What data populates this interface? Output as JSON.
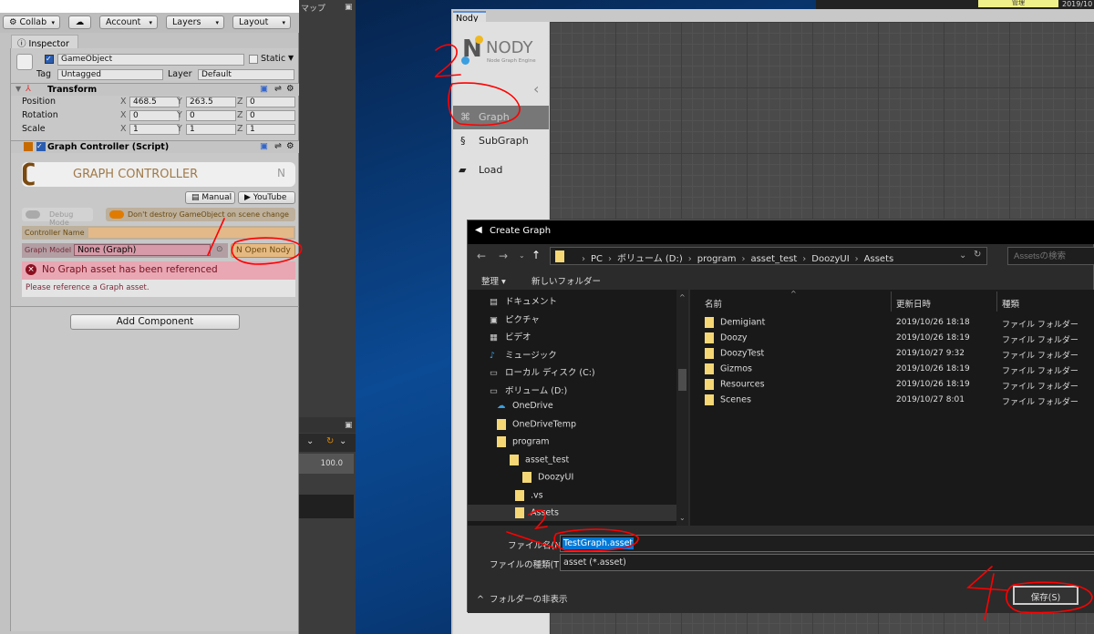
{
  "unity": {
    "toolbar": {
      "collab": "Collab",
      "account": "Account",
      "layers": "Layers",
      "layout": "Layout"
    },
    "inspector_tab": "Inspector",
    "map_tab": "マップ",
    "gameobject": {
      "name": "GameObject",
      "static_label": "Static",
      "tag_label": "Tag",
      "tag": "Untagged",
      "layer_label": "Layer",
      "layer": "Default"
    },
    "transform": {
      "title": "Transform",
      "rows": [
        {
          "label": "Position",
          "x": "468.5",
          "y": "263.5",
          "z": "0"
        },
        {
          "label": "Rotation",
          "x": "0",
          "y": "0",
          "z": "0"
        },
        {
          "label": "Scale",
          "x": "1",
          "y": "1",
          "z": "1"
        }
      ]
    },
    "axes": [
      "X",
      "Y",
      "Z"
    ],
    "graph_controller": {
      "title": "Graph Controller (Script)",
      "banner": "GRAPH CONTROLLER",
      "manual": "Manual",
      "youtube": "YouTube",
      "debug_mode": "Debug Mode",
      "dont_destroy": "Don't destroy GameObject on scene change",
      "controller_name_label": "Controller Name",
      "controller_name": "",
      "graph_model_label": "Graph Model",
      "graph_model": "None (Graph)",
      "open_nody": "Open Nody",
      "error_title": "No Graph asset has been referenced",
      "error_body": "Please reference a Graph asset."
    },
    "add_component": "Add Component",
    "zoom_value": "100.0"
  },
  "taskbar": {
    "manage": "管理",
    "date": "2019/10"
  },
  "nody": {
    "tab": "Nody",
    "logo": "NODY",
    "logo_sub": "Node Graph Engine",
    "nav": [
      {
        "label": "Graph",
        "selected": true
      },
      {
        "label": "SubGraph"
      },
      {
        "label": "Load"
      }
    ]
  },
  "dialog": {
    "title": "Create Graph",
    "breadcrumb": [
      "PC",
      "ボリューム (D:)",
      "program",
      "asset_test",
      "DoozyUI",
      "Assets"
    ],
    "search_placeholder": "Assetsの検索",
    "organize": "整理 ▾",
    "new_folder": "新しいフォルダー",
    "tree": [
      {
        "label": "ドキュメント",
        "icon": "document-icon"
      },
      {
        "label": "ピクチャ",
        "icon": "pictures-icon"
      },
      {
        "label": "ビデオ",
        "icon": "video-icon"
      },
      {
        "label": "ミュージック",
        "icon": "music-icon"
      },
      {
        "label": "ローカル ディスク (C:)",
        "icon": "drive-icon"
      },
      {
        "label": "ボリューム (D:)",
        "icon": "drive-icon"
      },
      {
        "label": "OneDrive",
        "icon": "cloud-icon"
      },
      {
        "label": "OneDriveTemp",
        "icon": "folder-icon"
      },
      {
        "label": "program",
        "icon": "folder-icon"
      },
      {
        "label": "asset_test",
        "icon": "folder-icon"
      },
      {
        "label": "DoozyUI",
        "icon": "folder-icon"
      },
      {
        "label": ".vs",
        "icon": "folder-icon"
      },
      {
        "label": "Assets",
        "icon": "folder-icon",
        "selected": true
      }
    ],
    "columns": [
      "名前",
      "更新日時",
      "種類"
    ],
    "files": [
      {
        "name": "Demigiant",
        "date": "2019/10/26 18:18",
        "type": "ファイル フォルダー"
      },
      {
        "name": "Doozy",
        "date": "2019/10/26 18:19",
        "type": "ファイル フォルダー"
      },
      {
        "name": "DoozyTest",
        "date": "2019/10/27 9:32",
        "type": "ファイル フォルダー"
      },
      {
        "name": "Gizmos",
        "date": "2019/10/26 18:19",
        "type": "ファイル フォルダー"
      },
      {
        "name": "Resources",
        "date": "2019/10/26 18:19",
        "type": "ファイル フォルダー"
      },
      {
        "name": "Scenes",
        "date": "2019/10/27 8:01",
        "type": "ファイル フォルダー"
      }
    ],
    "filename_label": "ファイル名(N):",
    "filename": "TestGraph.asset",
    "filetype_label": "ファイルの種類(T):",
    "filetype": "asset (*.asset)",
    "hide_folders": "フォルダーの非表示",
    "save": "保存(S)"
  },
  "colors": {
    "annotation": "#ff0000",
    "selection": "#0078d7",
    "error": "#e8a7b3",
    "accent": "#e07b00"
  }
}
